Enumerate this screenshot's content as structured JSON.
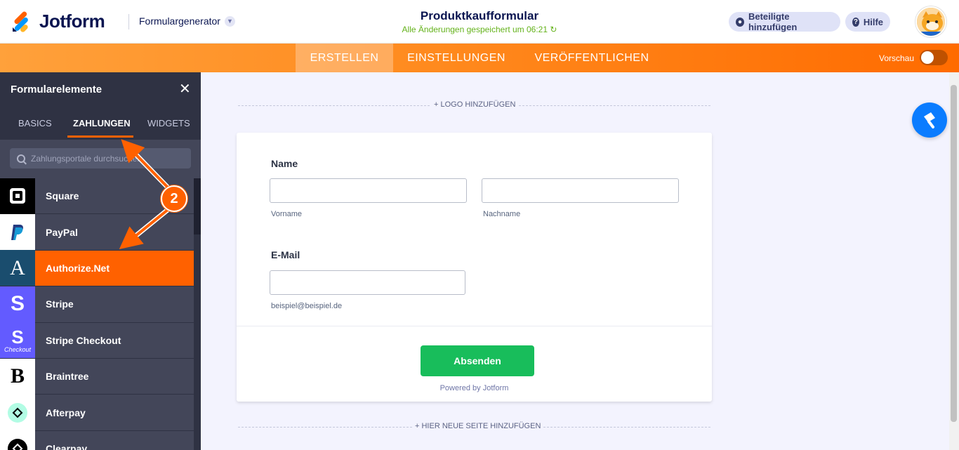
{
  "header": {
    "brand": "Jotform",
    "builder_menu": "Formulargenerator",
    "form_title": "Produktkaufformular",
    "save_status": "Alle Änderungen gespeichert um 06:21",
    "add_participants": "Beteiligte hinzufügen",
    "help": "Hilfe"
  },
  "nav": {
    "tabs": [
      "ERSTELLEN",
      "EINSTELLUNGEN",
      "VERÖFFENTLICHEN"
    ],
    "active_tab": "ERSTELLEN",
    "preview_label": "Vorschau",
    "preview_on": false
  },
  "sidebar": {
    "title": "Formularelemente",
    "tabs": [
      "BASICS",
      "ZAHLUNGEN",
      "WIDGETS"
    ],
    "active_tab": "ZAHLUNGEN",
    "search_placeholder": "Zahlungsportale durchsuchen",
    "gateways": [
      {
        "label": "Square",
        "icon": "square-icon"
      },
      {
        "label": "PayPal",
        "icon": "paypal-icon"
      },
      {
        "label": "Authorize.Net",
        "icon": "authorize-net-icon",
        "active": true
      },
      {
        "label": "Stripe",
        "icon": "stripe-icon"
      },
      {
        "label": "Stripe Checkout",
        "icon": "stripe-checkout-icon",
        "tile_caption": "Checkout"
      },
      {
        "label": "Braintree",
        "icon": "braintree-icon"
      },
      {
        "label": "Afterpay",
        "icon": "afterpay-icon"
      },
      {
        "label": "Clearpay",
        "icon": "clearpay-icon"
      }
    ]
  },
  "canvas": {
    "add_logo": "+ LOGO HINZUFÜGEN",
    "add_page": "+ HIER NEUE SEITE HINZUFÜGEN"
  },
  "form": {
    "name_label": "Name",
    "first_name_sublabel": "Vorname",
    "last_name_sublabel": "Nachname",
    "email_label": "E-Mail",
    "email_sublabel": "beispiel@beispiel.de",
    "submit_label": "Absenden",
    "powered_by": "Powered by Jotform"
  },
  "annotation": {
    "step_number": "2"
  },
  "colors": {
    "brand_orange": "#ff6100",
    "navy": "#0a1551",
    "submit_green": "#18bd5b",
    "sidebar_bg": "#434659"
  }
}
